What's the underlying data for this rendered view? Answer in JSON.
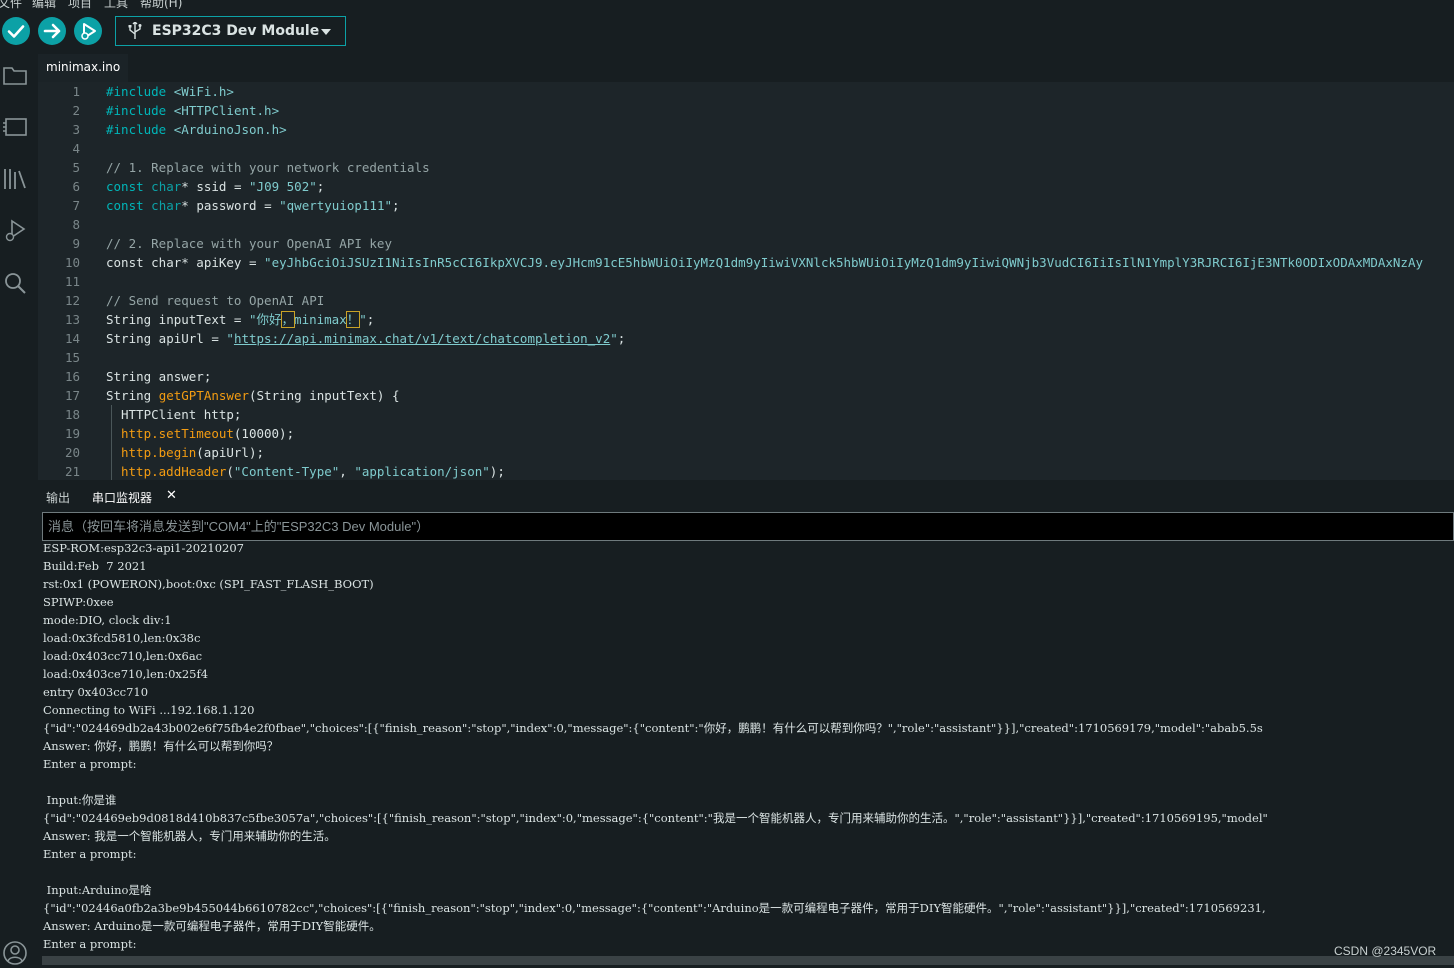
{
  "menu": {
    "items": [
      "文件",
      "编辑",
      "项目",
      "工具",
      "帮助(H)"
    ]
  },
  "toolbar": {
    "board": "ESP32C3 Dev Module"
  },
  "tab": {
    "filename": "minimax.ino"
  },
  "code": {
    "line_numbers": [
      "1",
      "2",
      "3",
      "4",
      "5",
      "6",
      "7",
      "8",
      "9",
      "10",
      "11",
      "12",
      "13",
      "14",
      "15",
      "16",
      "17",
      "18",
      "19",
      "20",
      "21"
    ],
    "l1": {
      "kw": "#include",
      "rest": " <WiFi.h>"
    },
    "l2": {
      "kw": "#include",
      "rest": " <HTTPClient.h>"
    },
    "l3": {
      "kw": "#include",
      "rest": " <ArduinoJson.h>"
    },
    "l5": "// 1. Replace with your network credentials",
    "l6": {
      "kw": "const",
      "ty": "char",
      "mid": "* ssid = ",
      "str": "\"J09 502\"",
      "end": ";"
    },
    "l7": {
      "kw": "const",
      "ty": "char",
      "mid": "* password = ",
      "str": "\"qwertyuiop111\"",
      "end": ";"
    },
    "l9": "// 2. Replace with your OpenAI API key",
    "l10": {
      "pre": "const char* apiKey = ",
      "str": "\"eyJhbGciOiJSUzI1NiIsInR5cCI6IkpXVCJ9.eyJHcm91cE5hbWUiOiIyMzQ1dm9yIiwiVXNlck5hbWUiOiIyMzQ1dm9yIiwiQWNjb3VudCI6IiIsIlN1YmplY3RJRCI6IjE3NTk0ODIxODAxMDAxNzAy"
    },
    "l12": "// Send request to OpenAI API",
    "l13": {
      "pre": "String inputText = ",
      "q1": "\"你好",
      "c1": "，",
      "mid": "minimax",
      "c2": "！",
      "q2": "\"",
      "end": ";"
    },
    "l14": {
      "pre": "String apiUrl = ",
      "q1": "\"",
      "url": "https://api.minimax.chat/v1/text/chatcompletion_v2",
      "q2": "\"",
      "end": ";"
    },
    "l16": "String answer;",
    "l17": {
      "pre": "String ",
      "fn": "getGPTAnswer",
      "rest": "(String inputText) {"
    },
    "l18": "HTTPClient http;",
    "l19": {
      "obj": "http.",
      "fn": "setTimeout",
      "rest": "(10000);"
    },
    "l20": {
      "obj": "http.",
      "fn": "begin",
      "rest": "(apiUrl);"
    },
    "l21": {
      "obj": "http.",
      "fn": "addHeader",
      "open": "(",
      "s1": "\"Content-Type\"",
      "sep": ", ",
      "s2": "\"application/json\"",
      "end": ");"
    }
  },
  "panel": {
    "tab_output": "输出",
    "tab_serial": "串口监视器",
    "close": "✕"
  },
  "message_input": {
    "placeholder": "消息（按回车将消息发送到\"COM4\"上的\"ESP32C3 Dev Module\"）"
  },
  "serial_lines": [
    "ESP-ROM:esp32c3-api1-20210207",
    "Build:Feb  7 2021",
    "rst:0x1 (POWERON),boot:0xc (SPI_FAST_FLASH_BOOT)",
    "SPIWP:0xee",
    "mode:DIO, clock div:1",
    "load:0x3fcd5810,len:0x38c",
    "load:0x403cc710,len:0x6ac",
    "load:0x403ce710,len:0x25f4",
    "entry 0x403cc710",
    "Connecting to WiFi ...192.168.1.120",
    "{\"id\":\"024469db2a43b002e6f75fb4e2f0fbae\",\"choices\":[{\"finish_reason\":\"stop\",\"index\":0,\"message\":{\"content\":\"你好，鹏鹏！有什么可以帮到你吗？\",\"role\":\"assistant\"}}],\"created\":1710569179,\"model\":\"abab5.5s",
    "Answer: 你好，鹏鹏！有什么可以帮到你吗？",
    "Enter a prompt:",
    "",
    " Input:你是谁",
    "{\"id\":\"024469eb9d0818d410b837c5fbe3057a\",\"choices\":[{\"finish_reason\":\"stop\",\"index\":0,\"message\":{\"content\":\"我是一个智能机器人，专门用来辅助你的生活。\",\"role\":\"assistant\"}}],\"created\":1710569195,\"model\"",
    "Answer: 我是一个智能机器人，专门用来辅助你的生活。",
    "Enter a prompt:",
    "",
    " Input:Arduino是啥",
    "{\"id\":\"02446a0fb2a3be9b455044b6610782cc\",\"choices\":[{\"finish_reason\":\"stop\",\"index\":0,\"message\":{\"content\":\"Arduino是一款可编程电子器件，常用于DIY智能硬件。\",\"role\":\"assistant\"}}],\"created\":1710569231,",
    "Answer: Arduino是一款可编程电子器件，常用于DIY智能硬件。",
    "Enter a prompt:"
  ],
  "watermark": "CSDN @2345VOR",
  "colors": {
    "accent": "#0ca1a6",
    "background": "#171e21",
    "editor": "#1d2529",
    "function": "#f39c12"
  }
}
